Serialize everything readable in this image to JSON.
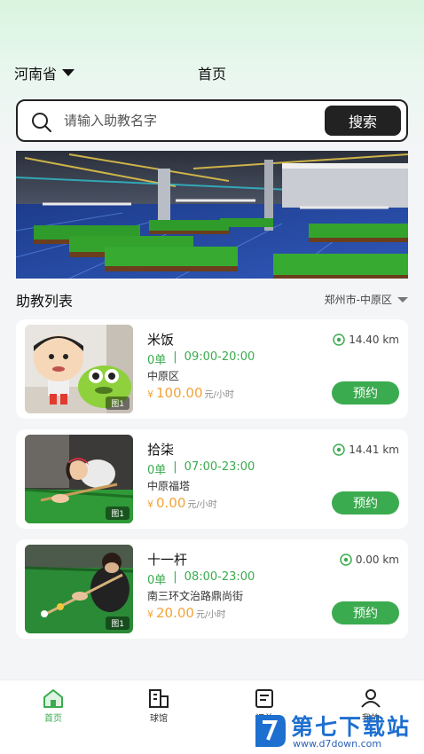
{
  "header": {
    "province": "河南省",
    "title": "首页"
  },
  "search": {
    "placeholder": "请输入助教名字",
    "button_label": "搜索"
  },
  "section": {
    "title": "助教列表",
    "region": "郑州市-中原区"
  },
  "coaches": [
    {
      "name": "米饭",
      "orders": "0单",
      "separator": "|",
      "hours": "09:00-20:00",
      "place": "中原区",
      "currency": "¥",
      "price": "100.00",
      "unit": "元/小时",
      "distance": "14.40 km",
      "book_label": "预约",
      "image_tag": "图1"
    },
    {
      "name": "拾柒",
      "orders": "0单",
      "separator": "|",
      "hours": "07:00-23:00",
      "place": "中原福塔",
      "currency": "¥",
      "price": "0.00",
      "unit": "元/小时",
      "distance": "14.41 km",
      "book_label": "预约",
      "image_tag": "图1"
    },
    {
      "name": "十一杆",
      "orders": "0单",
      "separator": "|",
      "hours": "08:00-23:00",
      "place": "南三环文治路鼎尚街",
      "currency": "¥",
      "price": "20.00",
      "unit": "元/小时",
      "distance": "0.00 km",
      "book_label": "预约",
      "image_tag": "图1"
    }
  ],
  "nav": [
    {
      "label": "首页",
      "icon": "home-icon",
      "active": true
    },
    {
      "label": "球馆",
      "icon": "venue-icon",
      "active": false
    },
    {
      "label": "订单",
      "icon": "order-icon",
      "active": false
    },
    {
      "label": "我的",
      "icon": "profile-icon",
      "active": false
    }
  ],
  "watermark": {
    "brand": "第七下载站",
    "url": "www.d7down.com"
  },
  "colors": {
    "accent": "#3bab4f",
    "price": "#f2a43a",
    "dark": "#222222"
  }
}
